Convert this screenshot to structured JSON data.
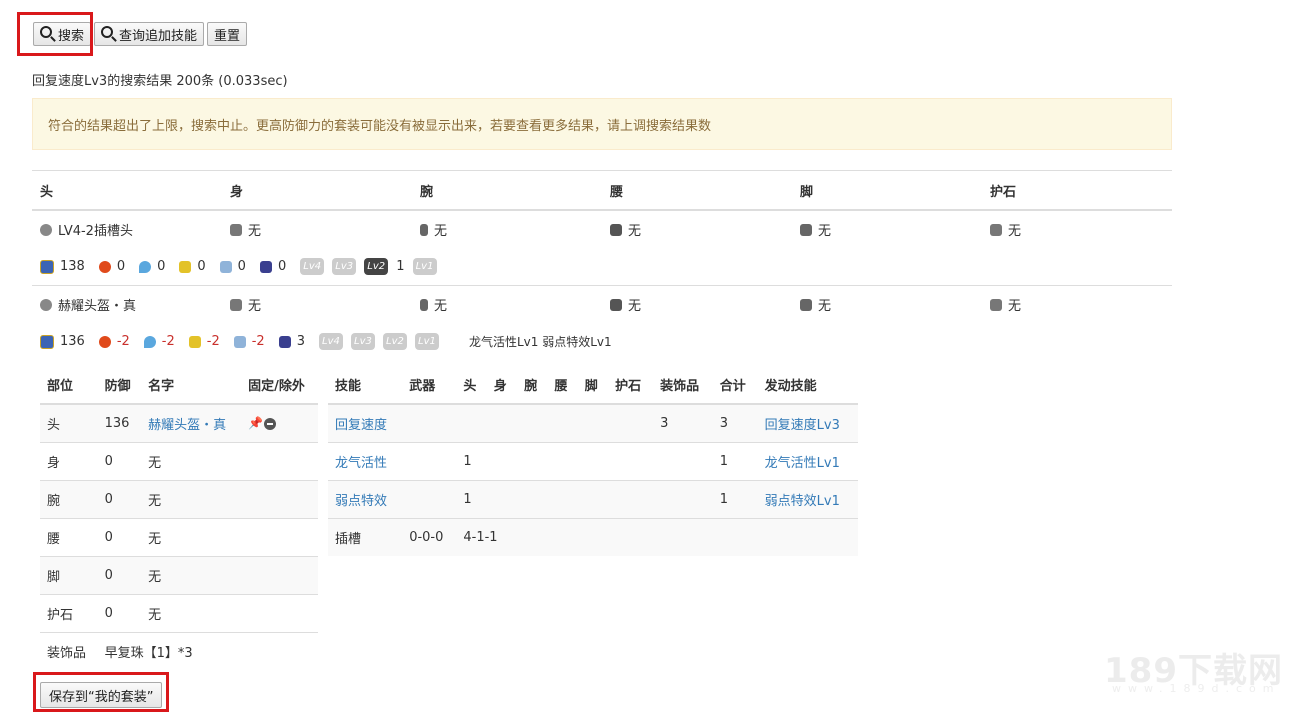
{
  "toolbar": {
    "search": "搜索",
    "query_skills": "查询追加技能",
    "reset": "重置"
  },
  "summary": "回复速度Lv3的搜索结果 200条 (0.033sec)",
  "alert": "符合的结果超出了上限，搜索中止。更高防御力的套装可能没有被显示出来，若要查看更多结果，请上调搜索结果数",
  "results": {
    "headers": [
      "头",
      "身",
      "腕",
      "腰",
      "脚",
      "护石"
    ],
    "sets": [
      {
        "parts": [
          "LV4-2插槽头",
          "无",
          "无",
          "无",
          "无",
          "无"
        ],
        "defense": "138",
        "fire": "0",
        "water": "0",
        "thunder": "0",
        "ice": "0",
        "dragon": "0",
        "slots": [
          "Lv4",
          "Lv3",
          "Lv2",
          "Lv1"
        ],
        "lv2_count": "1",
        "skills": ""
      },
      {
        "parts": [
          "赫耀头盔・真",
          "无",
          "无",
          "无",
          "无",
          "无"
        ],
        "defense": "136",
        "fire": "-2",
        "water": "-2",
        "thunder": "-2",
        "ice": "-2",
        "dragon": "3",
        "slots": [
          "Lv4",
          "Lv3",
          "Lv2",
          "Lv1"
        ],
        "skills": "龙气活性Lv1 弱点特效Lv1"
      }
    ]
  },
  "parts_table": {
    "headers": [
      "部位",
      "防御",
      "名字",
      "固定/除外"
    ],
    "rows": [
      {
        "part": "头",
        "def": "136",
        "name": "赫耀头盔・真"
      },
      {
        "part": "身",
        "def": "0",
        "name": "无"
      },
      {
        "part": "腕",
        "def": "0",
        "name": "无"
      },
      {
        "part": "腰",
        "def": "0",
        "name": "无"
      },
      {
        "part": "脚",
        "def": "0",
        "name": "无"
      },
      {
        "part": "护石",
        "def": "0",
        "name": "无"
      }
    ],
    "deco_label": "装饰品",
    "deco_value": "早复珠【1】*3"
  },
  "skill_table": {
    "headers": [
      "技能",
      "武器",
      "头",
      "身",
      "腕",
      "腰",
      "脚",
      "护石",
      "装饰品",
      "合计",
      "发动技能"
    ],
    "rows": [
      {
        "skill": "回复速度",
        "deco": "3",
        "total": "3",
        "active": "回复速度Lv3"
      },
      {
        "skill": "龙气活性",
        "head": "1",
        "total": "1",
        "active": "龙气活性Lv1"
      },
      {
        "skill": "弱点特效",
        "head": "1",
        "total": "1",
        "active": "弱点特效Lv1"
      }
    ],
    "slot_label": "插槽",
    "slot_weapon": "0-0-0",
    "slot_head": "4-1-1"
  },
  "save_button": "保存到“我的套装”",
  "watermark": {
    "main": "189下载网",
    "sub": "www.189d.com"
  },
  "colors": {
    "link": "#337ab7",
    "highlight_box": "#d9181b",
    "alert_bg": "#fcf8e3"
  }
}
